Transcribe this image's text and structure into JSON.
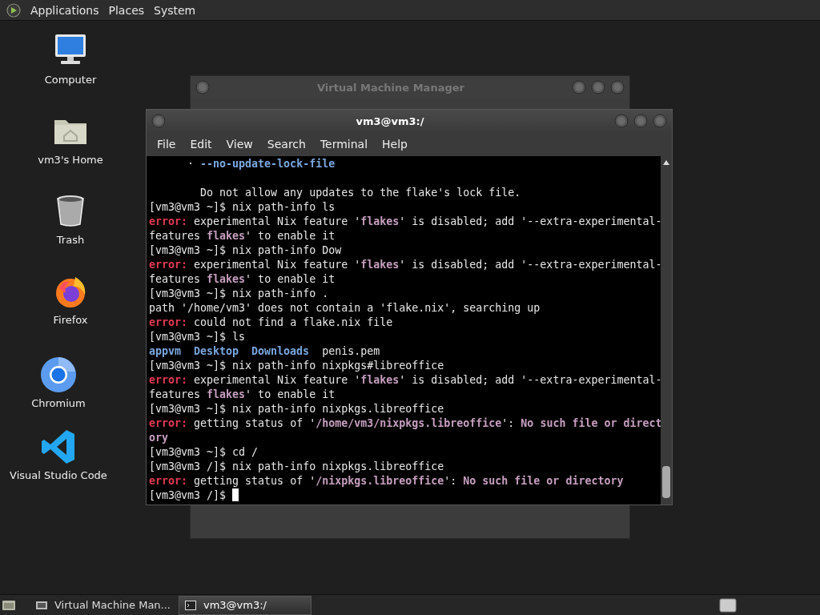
{
  "top_panel": {
    "menus": [
      "Applications",
      "Places",
      "System"
    ]
  },
  "desktop_icons": [
    {
      "label": "Computer",
      "kind": "computer"
    },
    {
      "label": "vm3's Home",
      "kind": "home"
    },
    {
      "label": "Trash",
      "kind": "trash"
    },
    {
      "label": "Firefox",
      "kind": "firefox"
    },
    {
      "label": "Chromium",
      "kind": "chromium"
    },
    {
      "label": "Visual Studio Code",
      "kind": "vscode"
    }
  ],
  "background_window": {
    "title": "Virtual Machine Manager"
  },
  "terminal_window": {
    "title": "vm3@vm3:/",
    "menu": [
      "File",
      "Edit",
      "View",
      "Search",
      "Terminal",
      "Help"
    ],
    "lines": [
      {
        "spans": [
          {
            "text": "      · ",
            "kind": "plain"
          },
          {
            "text": "--no-update-lock-file",
            "kind": "blue"
          }
        ]
      },
      {
        "gap_before": true,
        "spans": [
          {
            "text": "        Do not allow any updates to the flake's lock file.",
            "kind": "plain"
          }
        ]
      },
      {
        "spans": [
          {
            "text": "[vm3@vm3 ~]$ nix path-info ls",
            "kind": "plain"
          }
        ]
      },
      {
        "spans": [
          {
            "text": "error:",
            "kind": "error"
          },
          {
            "text": " experimental Nix feature '",
            "kind": "plain"
          },
          {
            "text": "flakes",
            "kind": "mauve"
          },
          {
            "text": "' is disabled; add '--extra-experimental-",
            "kind": "plain"
          }
        ]
      },
      {
        "spans": [
          {
            "text": "features ",
            "kind": "plain"
          },
          {
            "text": "flakes",
            "kind": "mauve"
          },
          {
            "text": "' to enable it",
            "kind": "plain"
          }
        ]
      },
      {
        "spans": [
          {
            "text": "[vm3@vm3 ~]$ nix path-info Dow",
            "kind": "plain"
          }
        ]
      },
      {
        "spans": [
          {
            "text": "error:",
            "kind": "error"
          },
          {
            "text": " experimental Nix feature '",
            "kind": "plain"
          },
          {
            "text": "flakes",
            "kind": "mauve"
          },
          {
            "text": "' is disabled; add '--extra-experimental-",
            "kind": "plain"
          }
        ]
      },
      {
        "spans": [
          {
            "text": "features ",
            "kind": "plain"
          },
          {
            "text": "flakes",
            "kind": "mauve"
          },
          {
            "text": "' to enable it",
            "kind": "plain"
          }
        ]
      },
      {
        "spans": [
          {
            "text": "[vm3@vm3 ~]$ nix path-info .",
            "kind": "plain"
          }
        ]
      },
      {
        "spans": [
          {
            "text": "path '/home/vm3' does not contain a 'flake.nix', searching up",
            "kind": "plain"
          }
        ]
      },
      {
        "spans": [
          {
            "text": "error:",
            "kind": "error"
          },
          {
            "text": " could not find a flake.nix file",
            "kind": "plain"
          }
        ]
      },
      {
        "spans": [
          {
            "text": "[vm3@vm3 ~]$ ls",
            "kind": "plain"
          }
        ]
      },
      {
        "spans": [
          {
            "text": "appvm",
            "kind": "blue"
          },
          {
            "text": "Desktop",
            "kind": "blue"
          },
          {
            "text": "Downloads",
            "kind": "blue"
          },
          {
            "text": "penis.pem",
            "kind": "plain"
          }
        ],
        "columns": true
      },
      {
        "spans": [
          {
            "text": "[vm3@vm3 ~]$ nix path-info nixpkgs#libreoffice",
            "kind": "plain"
          }
        ]
      },
      {
        "spans": [
          {
            "text": "error:",
            "kind": "error"
          },
          {
            "text": " experimental Nix feature '",
            "kind": "plain"
          },
          {
            "text": "flakes",
            "kind": "mauve"
          },
          {
            "text": "' is disabled; add '--extra-experimental-",
            "kind": "plain"
          }
        ]
      },
      {
        "spans": [
          {
            "text": "features ",
            "kind": "plain"
          },
          {
            "text": "flakes",
            "kind": "mauve"
          },
          {
            "text": "' to enable it",
            "kind": "plain"
          }
        ]
      },
      {
        "spans": [
          {
            "text": "[vm3@vm3 ~]$ nix path-info nixpkgs.libreoffice",
            "kind": "plain"
          }
        ]
      },
      {
        "spans": [
          {
            "text": "error:",
            "kind": "error"
          },
          {
            "text": " getting status of '",
            "kind": "plain"
          },
          {
            "text": "/home/vm3/nixpkgs.libreoffice",
            "kind": "mauve"
          },
          {
            "text": "': ",
            "kind": "plain"
          },
          {
            "text": "No such file or direct",
            "kind": "mauve"
          }
        ]
      },
      {
        "spans": [
          {
            "text": "ory",
            "kind": "mauve"
          }
        ]
      },
      {
        "spans": [
          {
            "text": "[vm3@vm3 ~]$ cd /",
            "kind": "plain"
          }
        ]
      },
      {
        "spans": [
          {
            "text": "[vm3@vm3 /]$ nix path-info nixpkgs.libreoffice",
            "kind": "plain"
          }
        ]
      },
      {
        "spans": [
          {
            "text": "error:",
            "kind": "error"
          },
          {
            "text": " getting status of '",
            "kind": "plain"
          },
          {
            "text": "/nixpkgs.libreoffice",
            "kind": "mauve"
          },
          {
            "text": "': ",
            "kind": "plain"
          },
          {
            "text": "No such file or directory",
            "kind": "mauve"
          }
        ]
      },
      {
        "spans": [
          {
            "text": "[vm3@vm3 /]$ ",
            "kind": "plain"
          }
        ],
        "cursor": true
      }
    ]
  },
  "taskbar": {
    "tasks": [
      {
        "label": "Virtual Machine Man...",
        "selected": false
      },
      {
        "label": "vm3@vm3:/",
        "selected": true
      }
    ]
  }
}
